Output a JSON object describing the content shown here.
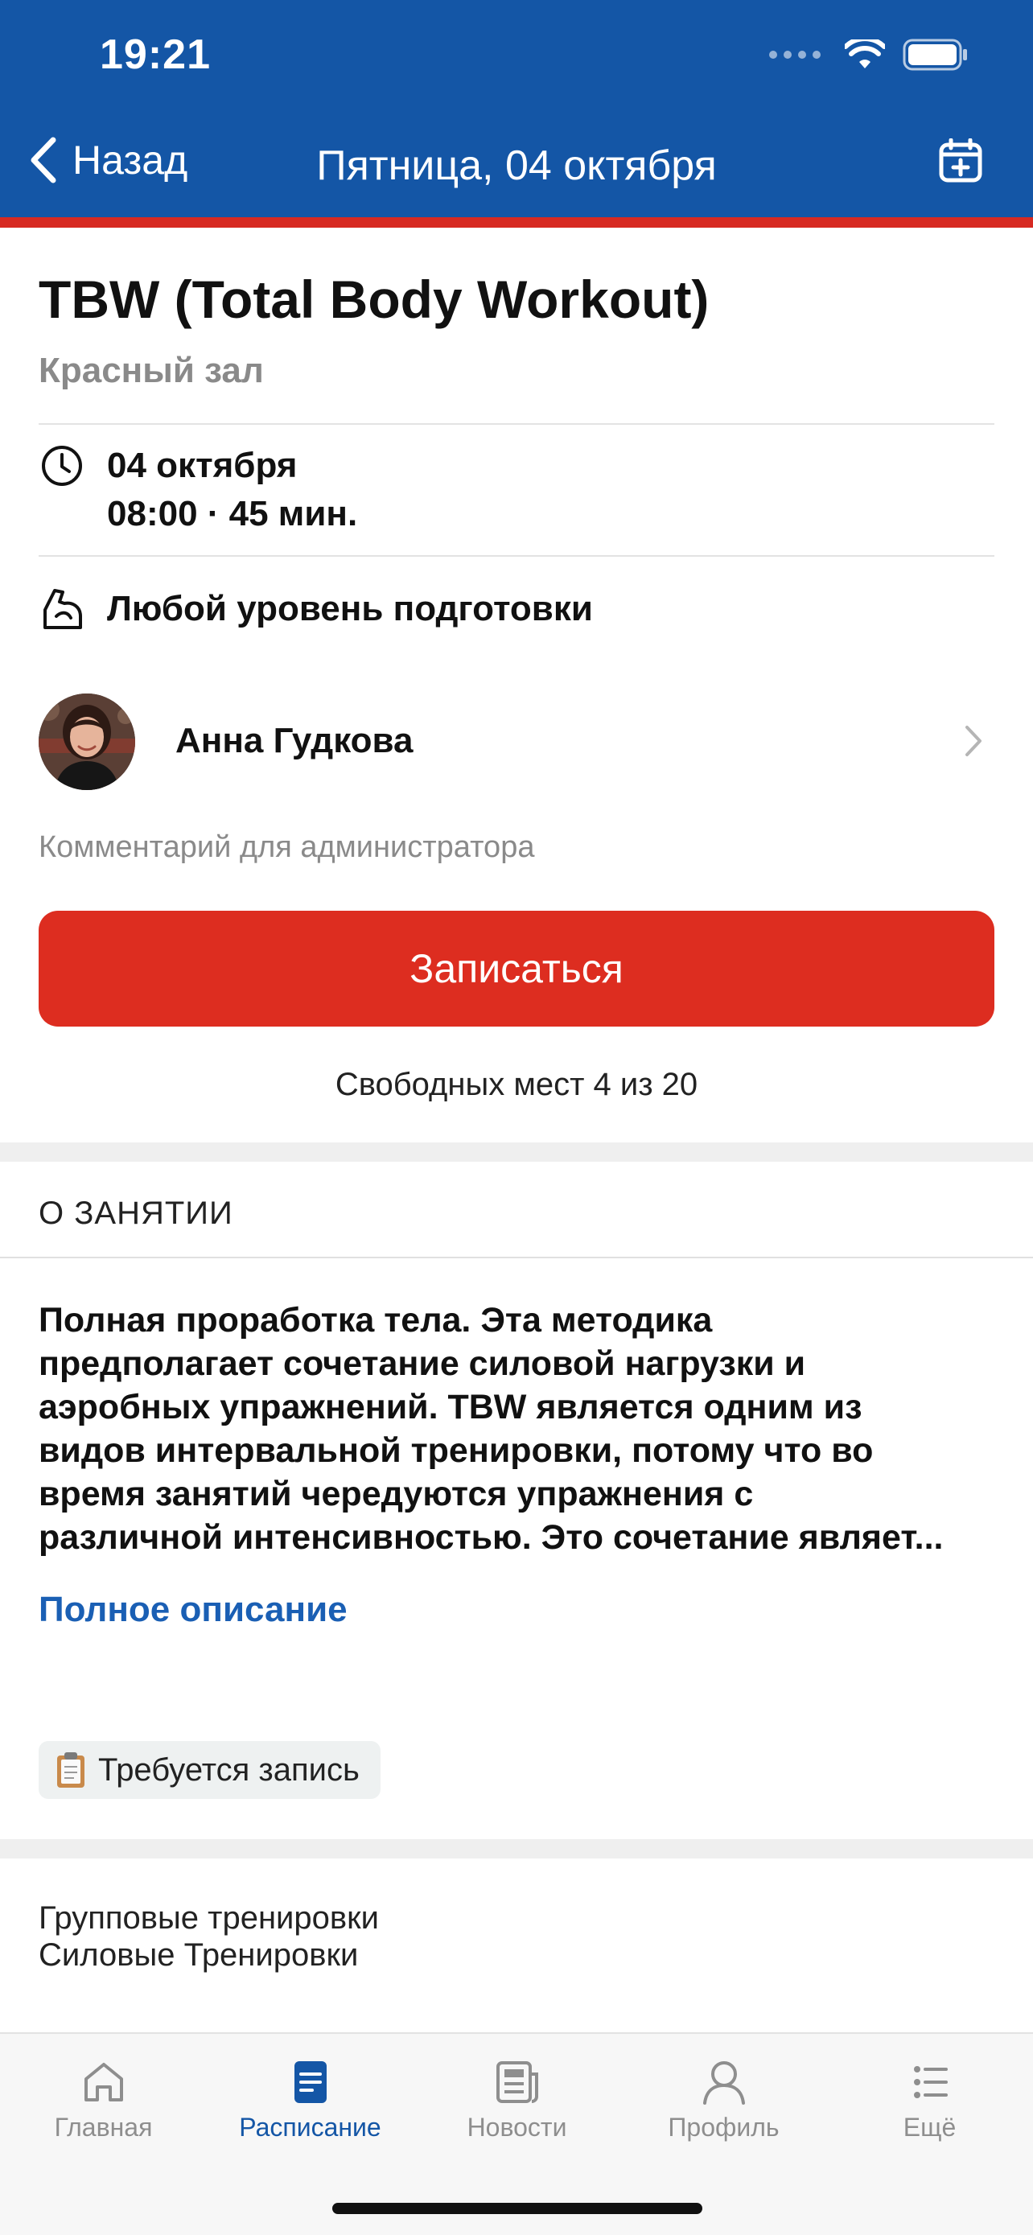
{
  "status_bar": {
    "time": "19:21"
  },
  "nav": {
    "back_label": "Назад",
    "title": "Пятница, 04 октября"
  },
  "class": {
    "title": "TBW (Total Body Workout)",
    "hall": "Красный зал",
    "date": "04 октября",
    "time_duration": "08:00 · 45 мин.",
    "level": "Любой уровень подготовки",
    "trainer": "Анна Гудкова",
    "admin_comment": "Комментарий для администратора",
    "signup_label": "Записаться",
    "free_places": "Свободных мест 4 из 20"
  },
  "about": {
    "section_title": "О ЗАНЯТИИ",
    "lines": [
      "Полная проработка тела. Эта методика",
      "предполагает сочетание силовой нагрузки и",
      "аэробных упражнений. TBW является одним из",
      "видов интервальной тренировки, потому что во",
      "время занятий чередуются упражнения с",
      "различной интенсивностью. Это сочетание являет..."
    ],
    "full_link": "Полное описание",
    "badge": "Требуется запись"
  },
  "categories": [
    "Групповые тренировки",
    "Силовые Тренировки"
  ],
  "tabbar": {
    "items": [
      {
        "label": "Главная",
        "icon": "home-icon"
      },
      {
        "label": "Расписание",
        "icon": "schedule-icon",
        "active": true
      },
      {
        "label": "Новости",
        "icon": "news-icon"
      },
      {
        "label": "Профиль",
        "icon": "profile-icon"
      },
      {
        "label": "Ещё",
        "icon": "more-icon"
      }
    ]
  },
  "colors": {
    "header": "#1456a6",
    "accent_red": "#dd2d20",
    "link": "#1a5fb4",
    "active_tab": "#1456a6"
  }
}
